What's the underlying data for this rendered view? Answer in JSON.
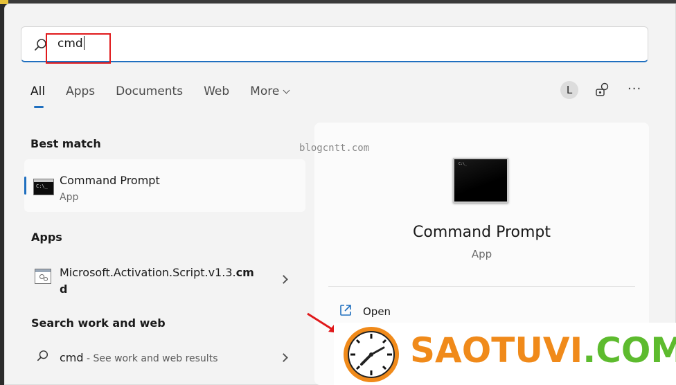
{
  "search": {
    "query": "cmd"
  },
  "tabs": [
    {
      "label": "All",
      "active": true
    },
    {
      "label": "Apps"
    },
    {
      "label": "Documents"
    },
    {
      "label": "Web"
    },
    {
      "label": "More"
    }
  ],
  "account": {
    "initial": "L"
  },
  "header_icons": [
    "chat-icon",
    "more-icon"
  ],
  "best_match": {
    "heading": "Best match",
    "title": "Command Prompt",
    "subtitle": "App"
  },
  "apps": {
    "heading": "Apps",
    "items": [
      {
        "title_line1": "Microsoft.Activation.Script.v1.3.",
        "title_bold1": "cm",
        "title_bold2": "d"
      }
    ]
  },
  "web": {
    "heading": "Search work and web",
    "query": "cmd",
    "suffix": " - See work and web results"
  },
  "details": {
    "title": "Command Prompt",
    "subtitle": "App",
    "actions": [
      {
        "label": "Open",
        "icon": "open-external-icon"
      }
    ]
  },
  "console_glyph": "C:\\_",
  "watermark": {
    "blog": "blogcntt.com",
    "logo_orange": "SAOTUVI",
    "logo_green": ".COM"
  },
  "colors": {
    "accent": "#1f6fbf",
    "highlight_box": "#e0191b",
    "logo_orange": "#f08a1a",
    "logo_green": "#5dbb2e"
  }
}
